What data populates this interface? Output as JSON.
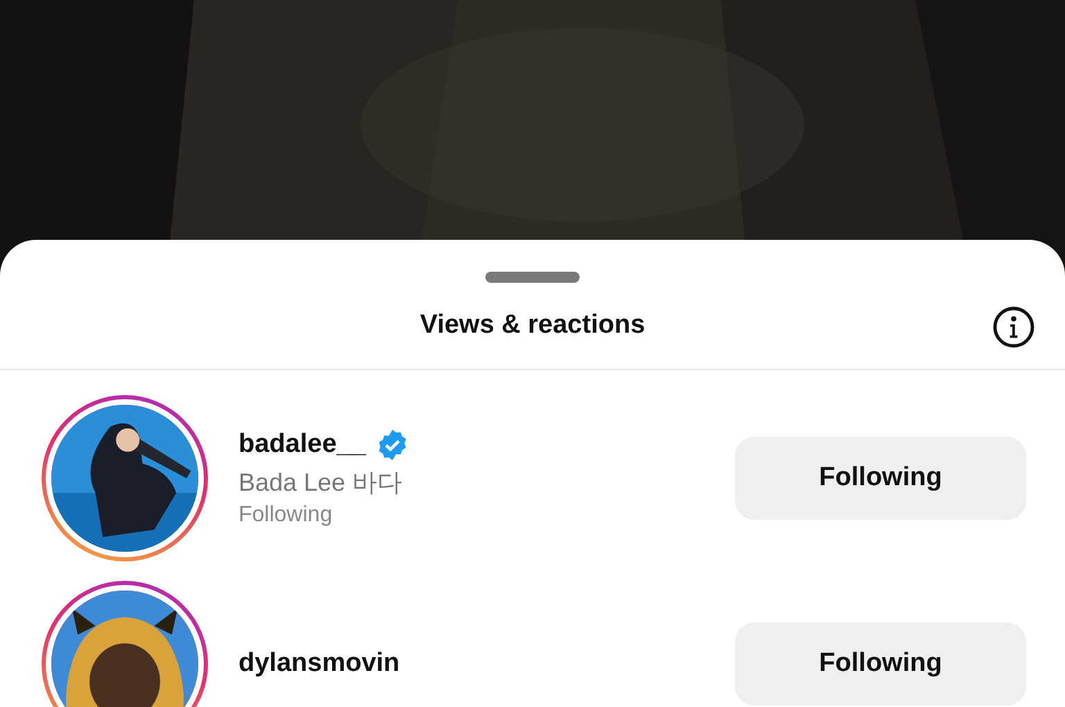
{
  "sheet": {
    "title": "Views & reactions"
  },
  "viewers": [
    {
      "username": "badalee__",
      "verified": true,
      "name": "Bada Lee 바다",
      "relation": "Following",
      "button": "Following"
    },
    {
      "username": "dylansmovin",
      "verified": false,
      "button": "Following"
    }
  ]
}
